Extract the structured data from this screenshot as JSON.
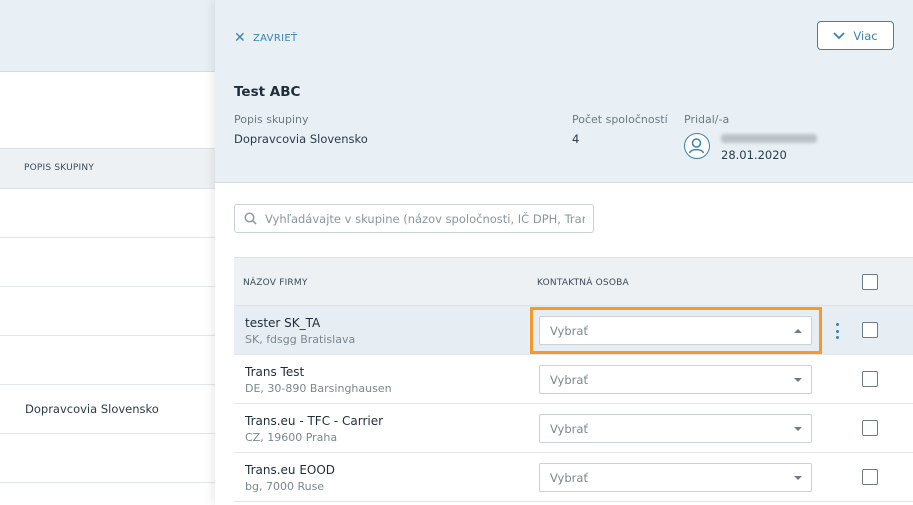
{
  "background": {
    "column_header": "POPIS SKUPINY",
    "row_group_desc": "Dopravcovia Slovensko"
  },
  "panel": {
    "close_label": "ZAVRIEŤ",
    "more_label": "Viac",
    "group_title": "Test ABC",
    "description_label": "Popis skupiny",
    "description_value": "Dopravcovia Slovensko",
    "company_count_label": "Počet spoločností",
    "company_count_value": "4",
    "added_by_label": "Pridal/-a",
    "added_date": "28.01.2020"
  },
  "search": {
    "placeholder": "Vyhľadávajte v skupine (názov spoločnosti, IČ DPH, Tran..."
  },
  "table": {
    "col_firm": "NÁZOV FIRMY",
    "col_contact": "KONTAKTNÁ OSOBA",
    "rows": [
      {
        "name": "tester SK_TA",
        "sub": "SK, fdsgg Bratislava",
        "select": "Vybrať"
      },
      {
        "name": "Trans Test",
        "sub": "DE, 30-890 Barsinghausen",
        "select": "Vybrať"
      },
      {
        "name": "Trans.eu - TFC - Carrier",
        "sub": "CZ, 19600 Praha",
        "select": "Vybrať"
      },
      {
        "name": "Trans.eu EOOD",
        "sub": "bg, 7000 Ruse",
        "select": "Vybrať"
      }
    ]
  },
  "colors": {
    "accent": "#3a82b0",
    "highlight": "#f59a2a",
    "header_bg": "#e8f0f5"
  },
  "icons": {
    "close": "close-icon",
    "more": "chevron-down-icon",
    "search": "search-icon",
    "avatar": "user-icon",
    "row_menu": "kebab-menu-icon"
  }
}
